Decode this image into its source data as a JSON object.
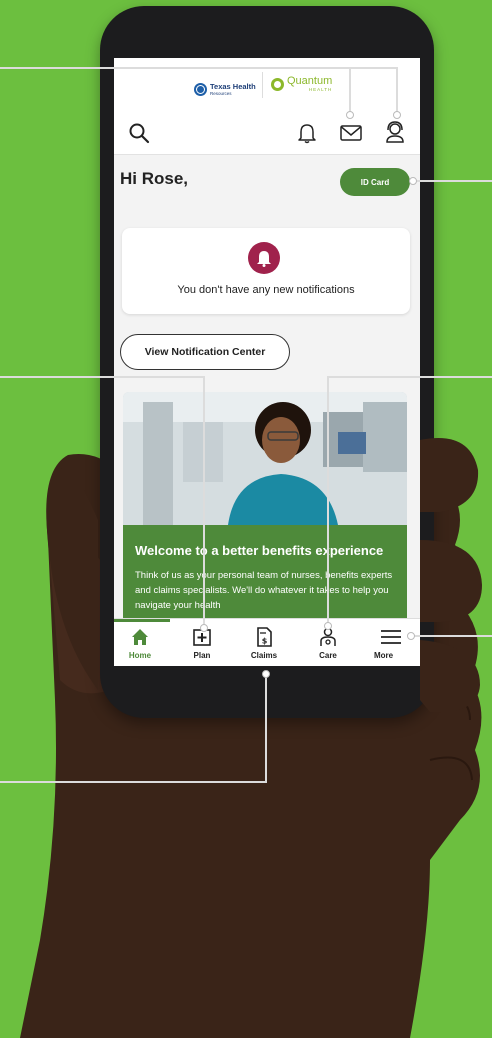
{
  "brand": {
    "logo1_line1": "Texas Health",
    "logo1_line2": "Resources",
    "logo2_name": "Quantum",
    "logo2_sub": "HEALTH"
  },
  "header": {
    "greeting": "Hi Rose,",
    "id_card_label": "ID Card"
  },
  "notifications": {
    "empty_message": "You don't have any new notifications",
    "center_button": "View Notification Center"
  },
  "promo": {
    "title": "Welcome to a better benefits experience",
    "body": "Think of us as your personal team of nurses, benefits experts and claims specialists. We'll do whatever it takes to help you navigate your health"
  },
  "nav": {
    "items": [
      {
        "label": "Home",
        "icon": "home-icon",
        "active": true
      },
      {
        "label": "Plan",
        "icon": "plan-icon"
      },
      {
        "label": "Claims",
        "icon": "claims-icon"
      },
      {
        "label": "Care",
        "icon": "care-icon"
      },
      {
        "label": "More",
        "icon": "menu-icon"
      }
    ]
  },
  "colors": {
    "background": "#6cbf3f",
    "brand_green": "#4e8a3a",
    "bell_badge": "#a0224c"
  }
}
